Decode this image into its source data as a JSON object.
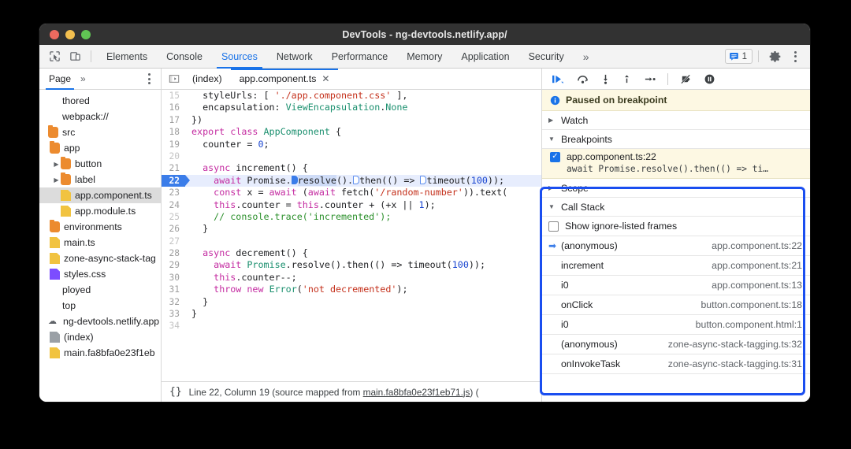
{
  "window": {
    "title": "DevTools - ng-devtools.netlify.app/"
  },
  "main_tabs": {
    "inspect_icon": "inspect-cursor-icon",
    "device_icon": "device-toolbar-icon",
    "items": [
      {
        "label": "Elements",
        "active": false
      },
      {
        "label": "Console",
        "active": false
      },
      {
        "label": "Sources",
        "active": true
      },
      {
        "label": "Network",
        "active": false
      },
      {
        "label": "Performance",
        "active": false
      },
      {
        "label": "Memory",
        "active": false
      },
      {
        "label": "Application",
        "active": false
      },
      {
        "label": "Security",
        "active": false
      }
    ],
    "overflow": "»",
    "message_count": "1",
    "settings_icon": "gear-icon",
    "more_icon": "kebab-menu-icon"
  },
  "navigator": {
    "tab_label": "Page",
    "overflow": "»",
    "more_icon": "kebab-menu-icon",
    "tree": [
      {
        "label": "thored",
        "indent": 0,
        "icon": "none",
        "arrow": "",
        "selected": false
      },
      {
        "label": "webpack://",
        "indent": 0,
        "icon": "none",
        "arrow": "",
        "selected": false
      },
      {
        "label": "src",
        "indent": 0,
        "icon": "folder",
        "arrow": "",
        "selected": false
      },
      {
        "label": "app",
        "indent": 1,
        "icon": "folder",
        "arrow": "",
        "selected": false
      },
      {
        "label": "button",
        "indent": 2,
        "icon": "folder",
        "arrow": "▶",
        "selected": false
      },
      {
        "label": "label",
        "indent": 2,
        "icon": "folder",
        "arrow": "▶",
        "selected": false
      },
      {
        "label": "app.component.ts",
        "indent": 2,
        "icon": "file",
        "arrow": "",
        "selected": true
      },
      {
        "label": "app.module.ts",
        "indent": 2,
        "icon": "file",
        "arrow": "",
        "selected": false
      },
      {
        "label": "environments",
        "indent": 1,
        "icon": "folder",
        "arrow": "",
        "selected": false
      },
      {
        "label": "main.ts",
        "indent": 1,
        "icon": "file",
        "arrow": "",
        "selected": false
      },
      {
        "label": "zone-async-stack-tag",
        "indent": 1,
        "icon": "file",
        "arrow": "",
        "selected": false
      },
      {
        "label": "styles.css",
        "indent": 1,
        "icon": "file-purple",
        "arrow": "",
        "selected": false
      },
      {
        "label": "ployed",
        "indent": 0,
        "icon": "none",
        "arrow": "",
        "selected": false
      },
      {
        "label": "top",
        "indent": 0,
        "icon": "none",
        "arrow": "",
        "selected": false
      },
      {
        "label": "ng-devtools.netlify.app",
        "indent": 0,
        "icon": "cloud",
        "arrow": "",
        "selected": false
      },
      {
        "label": "(index)",
        "indent": 1,
        "icon": "file-gray",
        "arrow": "",
        "selected": false
      },
      {
        "label": "main.fa8bfa0e23f1eb",
        "indent": 1,
        "icon": "file",
        "arrow": "",
        "selected": false
      }
    ]
  },
  "editor": {
    "panel_toggle_icon": "show-navigator-icon",
    "tabs": [
      {
        "label": "(index)",
        "active": false,
        "closable": false
      },
      {
        "label": "app.component.ts",
        "active": true,
        "closable": true,
        "close": "✕"
      }
    ],
    "highlighted_line": 22,
    "lines": [
      {
        "n": "15",
        "dim": true,
        "text": "  styleUrls: [ './app.component.css' ],"
      },
      {
        "n": "16",
        "dim": false,
        "text": "  encapsulation: ViewEncapsulation.None"
      },
      {
        "n": "17",
        "dim": false,
        "text": "})"
      },
      {
        "n": "18",
        "dim": false,
        "text": "export class AppComponent {"
      },
      {
        "n": "19",
        "dim": false,
        "text": "  counter = 0;"
      },
      {
        "n": "20",
        "dim": true,
        "text": ""
      },
      {
        "n": "21",
        "dim": false,
        "text": "  async increment() {"
      },
      {
        "n": "22",
        "dim": false,
        "text": "    await Promise.resolve().then(() => timeout(100));"
      },
      {
        "n": "23",
        "dim": false,
        "text": "    const x = await (await fetch('/random-number')).text("
      },
      {
        "n": "24",
        "dim": false,
        "text": "    this.counter = this.counter + (+x || 1);"
      },
      {
        "n": "25",
        "dim": true,
        "text": "    // console.trace('incremented');"
      },
      {
        "n": "26",
        "dim": false,
        "text": "  }"
      },
      {
        "n": "27",
        "dim": true,
        "text": ""
      },
      {
        "n": "28",
        "dim": false,
        "text": "  async decrement() {"
      },
      {
        "n": "29",
        "dim": false,
        "text": "    await Promise.resolve().then(() => timeout(100));"
      },
      {
        "n": "30",
        "dim": false,
        "text": "    this.counter--;"
      },
      {
        "n": "31",
        "dim": false,
        "text": "    throw new Error('not decremented');"
      },
      {
        "n": "32",
        "dim": false,
        "text": "  }"
      },
      {
        "n": "33",
        "dim": false,
        "text": "}"
      },
      {
        "n": "34",
        "dim": true,
        "text": ""
      }
    ]
  },
  "status_bar": {
    "format_icon": "{}",
    "text": "Line 22, Column 19 (source mapped from ",
    "link": "main.fa8bfa0e23f1eb71.js",
    "suffix": ") ("
  },
  "debugger": {
    "toolbar": [
      {
        "name": "resume-button",
        "icon": "resume-icon"
      },
      {
        "name": "step-over-button",
        "icon": "step-over-icon"
      },
      {
        "name": "step-into-button",
        "icon": "step-into-icon"
      },
      {
        "name": "step-out-button",
        "icon": "step-out-icon"
      },
      {
        "name": "step-button",
        "icon": "step-icon"
      },
      {
        "name": "deactivate-breakpoints-button",
        "icon": "deactivate-breakpoints-icon"
      },
      {
        "name": "pause-on-exceptions-button",
        "icon": "pause-on-exceptions-icon"
      }
    ],
    "paused_banner": {
      "icon": "info-icon",
      "text": "Paused on breakpoint"
    },
    "watch": {
      "label": "Watch",
      "tri": "▶"
    },
    "breakpoints": {
      "label": "Breakpoints",
      "tri": "▼",
      "items": [
        {
          "checked": true,
          "check": "✓",
          "name": "app.component.ts:22",
          "code": "await Promise.resolve().then(() => ti…"
        }
      ]
    },
    "scope": {
      "label": "Scope",
      "tri": "▶"
    },
    "call_stack": {
      "label": "Call Stack",
      "tri": "▼",
      "highlight_color": "#1a4ef0",
      "show_ignore_listed": {
        "label": "Show ignore-listed frames",
        "checked": false
      },
      "frames": [
        {
          "selected": true,
          "marker": "➡",
          "fn": "(anonymous)",
          "loc": "app.component.ts:22"
        },
        {
          "selected": false,
          "marker": "",
          "fn": "increment",
          "loc": "app.component.ts:21"
        },
        {
          "selected": false,
          "marker": "",
          "fn": "i0",
          "loc": "app.component.ts:13"
        },
        {
          "selected": false,
          "marker": "",
          "fn": "onClick",
          "loc": "button.component.ts:18"
        },
        {
          "selected": false,
          "marker": "",
          "fn": "i0",
          "loc": "button.component.html:1"
        },
        {
          "selected": false,
          "marker": "",
          "fn": "(anonymous)",
          "loc": "zone-async-stack-tagging.ts:32"
        },
        {
          "selected": false,
          "marker": "",
          "fn": "onInvokeTask",
          "loc": "zone-async-stack-tagging.ts:31"
        }
      ]
    }
  }
}
